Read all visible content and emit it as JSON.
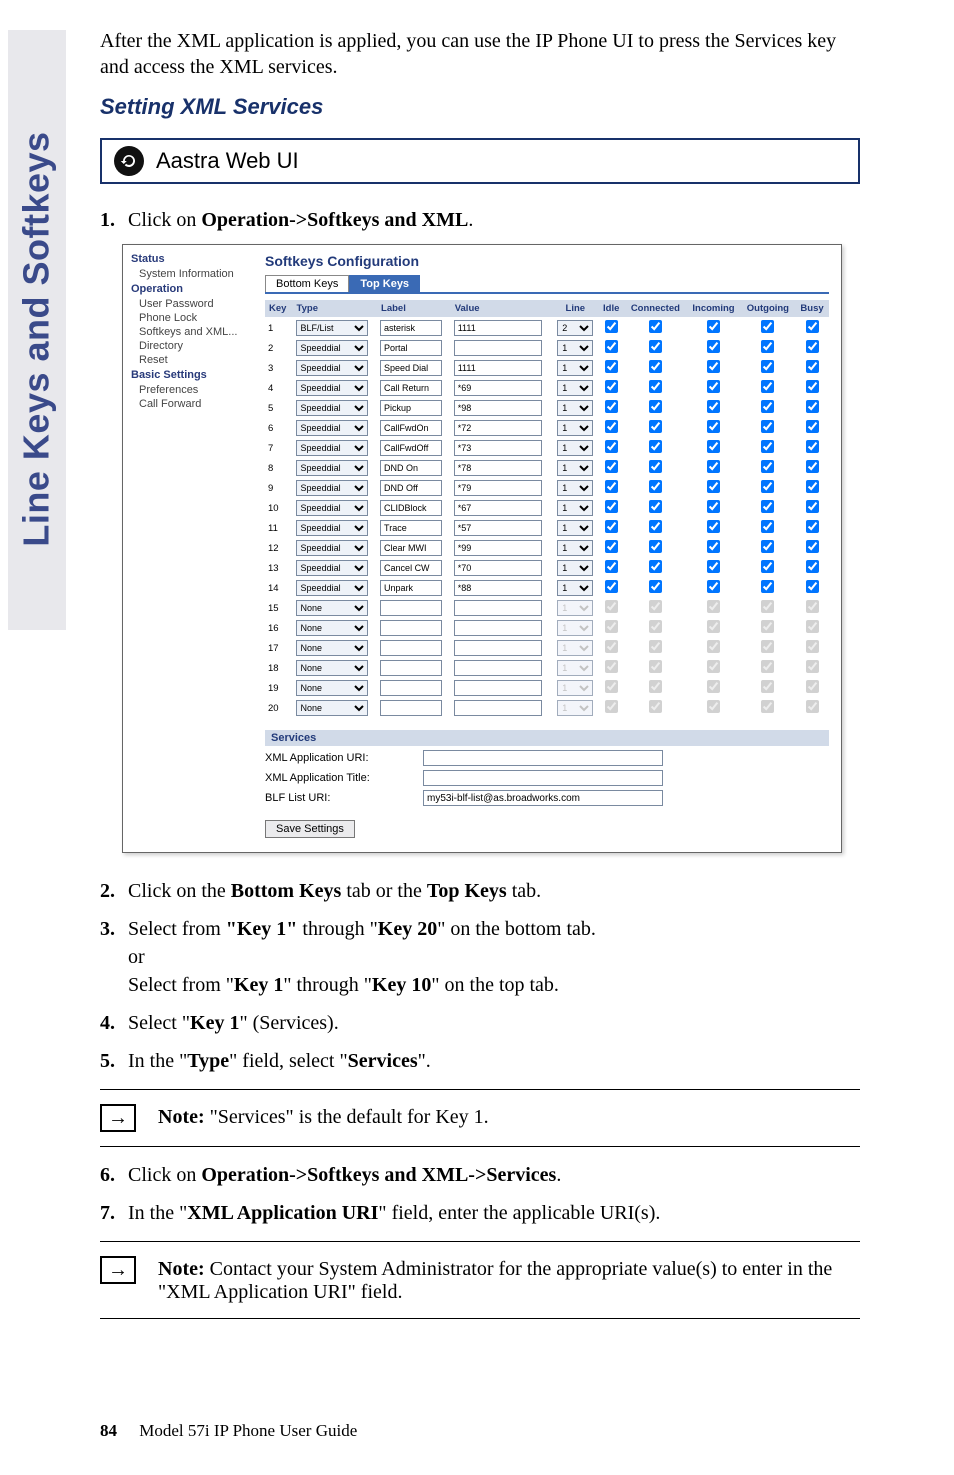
{
  "sidetab": "Line Keys and Softkeys",
  "intro": "After the XML application is applied, you can use the IP Phone UI to press the Services key and access the XML services.",
  "subheading": "Setting XML Services",
  "webui": "Aastra Web UI",
  "steps_a": {
    "s1_prefix": "Click on ",
    "s1_bold": "Operation->Softkeys and XML",
    "s1_suffix": "."
  },
  "screenshot": {
    "title": "Softkeys Configuration",
    "nav": {
      "status": "Status",
      "sysinfo": "System Information",
      "operation": "Operation",
      "items_a": [
        "User Password",
        "Phone Lock",
        "Softkeys and XML...",
        "Directory",
        "Reset"
      ],
      "basic": "Basic Settings",
      "items_b": [
        "Preferences",
        "Call Forward"
      ]
    },
    "tabs": {
      "bottom": "Bottom Keys",
      "top": "Top Keys"
    },
    "headers": [
      "Key",
      "Type",
      "Label",
      "Value",
      "Line",
      "Idle",
      "Connected",
      "Incoming",
      "Outgoing",
      "Busy"
    ],
    "rows": [
      {
        "k": "1",
        "type": "BLF/List",
        "label": "asterisk",
        "value": "1111",
        "line": "2",
        "en": true
      },
      {
        "k": "2",
        "type": "Speeddial",
        "label": "Portal",
        "value": "",
        "line": "1",
        "en": true
      },
      {
        "k": "3",
        "type": "Speeddial",
        "label": "Speed Dial",
        "value": "1111",
        "line": "1",
        "en": true
      },
      {
        "k": "4",
        "type": "Speeddial",
        "label": "Call Return",
        "value": "*69",
        "line": "1",
        "en": true
      },
      {
        "k": "5",
        "type": "Speeddial",
        "label": "Pickup",
        "value": "*98",
        "line": "1",
        "en": true
      },
      {
        "k": "6",
        "type": "Speeddial",
        "label": "CallFwdOn",
        "value": "*72",
        "line": "1",
        "en": true
      },
      {
        "k": "7",
        "type": "Speeddial",
        "label": "CallFwdOff",
        "value": "*73",
        "line": "1",
        "en": true
      },
      {
        "k": "8",
        "type": "Speeddial",
        "label": "DND On",
        "value": "*78",
        "line": "1",
        "en": true
      },
      {
        "k": "9",
        "type": "Speeddial",
        "label": "DND Off",
        "value": "*79",
        "line": "1",
        "en": true
      },
      {
        "k": "10",
        "type": "Speeddial",
        "label": "CLIDBlock",
        "value": "*67",
        "line": "1",
        "en": true
      },
      {
        "k": "11",
        "type": "Speeddial",
        "label": "Trace",
        "value": "*57",
        "line": "1",
        "en": true
      },
      {
        "k": "12",
        "type": "Speeddial",
        "label": "Clear MWI",
        "value": "*99",
        "line": "1",
        "en": true
      },
      {
        "k": "13",
        "type": "Speeddial",
        "label": "Cancel CW",
        "value": "*70",
        "line": "1",
        "en": true
      },
      {
        "k": "14",
        "type": "Speeddial",
        "label": "Unpark",
        "value": "*88",
        "line": "1",
        "en": true
      },
      {
        "k": "15",
        "type": "None",
        "label": "",
        "value": "",
        "line": "1",
        "en": false
      },
      {
        "k": "16",
        "type": "None",
        "label": "",
        "value": "",
        "line": "1",
        "en": false
      },
      {
        "k": "17",
        "type": "None",
        "label": "",
        "value": "",
        "line": "1",
        "en": false
      },
      {
        "k": "18",
        "type": "None",
        "label": "",
        "value": "",
        "line": "1",
        "en": false
      },
      {
        "k": "19",
        "type": "None",
        "label": "",
        "value": "",
        "line": "1",
        "en": false
      },
      {
        "k": "20",
        "type": "None",
        "label": "",
        "value": "",
        "line": "1",
        "en": false
      }
    ],
    "services": {
      "head": "Services",
      "uri_label": "XML Application URI:",
      "title_label": "XML Application Title:",
      "blf_label": "BLF List URI:",
      "blf_value": "my53i-blf-list@as.broadworks.com",
      "save": "Save Settings"
    }
  },
  "steps_b": {
    "s2a": "Click on the ",
    "s2b": "Bottom Keys",
    "s2c": " tab or the ",
    "s2d": "Top Keys",
    "s2e": " tab.",
    "s3a": "Select from ",
    "s3b": "\"Key 1\"",
    "s3c": " through \"",
    "s3d": "Key 20",
    "s3e": "\" on the bottom tab.",
    "s3or": "or",
    "s3f": "Select from \"",
    "s3g": "Key 1",
    "s3h": "\" through \"",
    "s3i": "Key 10",
    "s3j": "\" on the top tab.",
    "s4a": "Select \"",
    "s4b": "Key 1",
    "s4c": "\" (Services).",
    "s5a": "In the \"",
    "s5b": "Type",
    "s5c": "\" field, select \"",
    "s5d": "Services",
    "s5e": "\"."
  },
  "note1": {
    "label": "Note: ",
    "text": "\"Services\" is the default for Key 1."
  },
  "steps_c": {
    "s6a": "Click on ",
    "s6b": "Operation->Softkeys and XML->Services",
    "s6c": ".",
    "s7a": "In the \"",
    "s7b": "XML Application URI",
    "s7c": "\" field, enter the applicable URI(s)."
  },
  "note2": {
    "label": "Note: ",
    "text": "Contact your System Administrator for the appropriate value(s) to enter in the \"XML Application URI\" field."
  },
  "footer": {
    "page": "84",
    "title": "Model 57i IP Phone User Guide"
  }
}
